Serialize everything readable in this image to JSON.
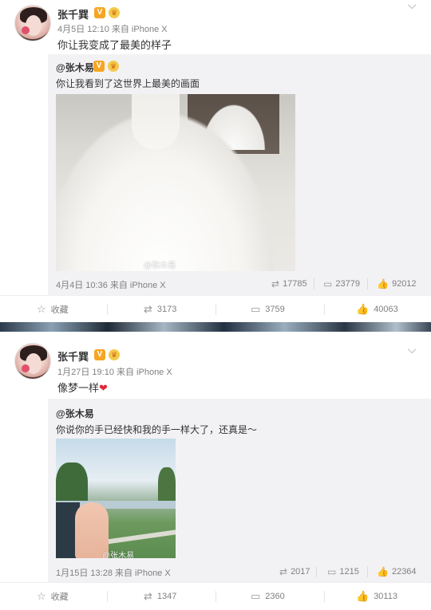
{
  "posts": [
    {
      "author": "张千巽",
      "vip_badge": "V",
      "meta": "4月5日 12:10 来自 iPhone X",
      "text": "你让我变成了最美的样子",
      "repost": {
        "author": "@张木易",
        "text": "你让我看到了这世界上最美的画面",
        "image_watermark": "@张木易",
        "meta": "4月4日 10:36 来自 iPhone X",
        "stats": {
          "reposts": "17785",
          "comments": "23779",
          "likes": "92012"
        }
      },
      "actions": {
        "favorite": "收藏",
        "reposts": "3173",
        "comments": "3759",
        "likes": "40063"
      }
    },
    {
      "author": "张千巽",
      "vip_badge": "V",
      "meta": "1月27日 19:10 来自 iPhone X",
      "text": "像梦一样",
      "text_emoji": "❤",
      "repost": {
        "author": "@张木易",
        "text": "你说你的手已经快和我的手一样大了，还真是～",
        "image_watermark": "@张木易",
        "meta": "1月15日 13:28 来自 iPhone X",
        "stats": {
          "reposts": "2017",
          "comments": "1215",
          "likes": "22364"
        }
      },
      "actions": {
        "favorite": "收藏",
        "reposts": "1347",
        "comments": "2360",
        "likes": "30113"
      }
    }
  ],
  "icons": {
    "chevron": "chevron-down-icon",
    "repost": "repost-icon",
    "comment": "comment-icon",
    "like": "thumbs-up-icon",
    "favorite": "star-icon"
  },
  "colors": {
    "vip_badge": "#f6a623",
    "meta_gray": "#808080",
    "repost_bg": "#f2f2f5",
    "heart": "#e02a3c"
  }
}
